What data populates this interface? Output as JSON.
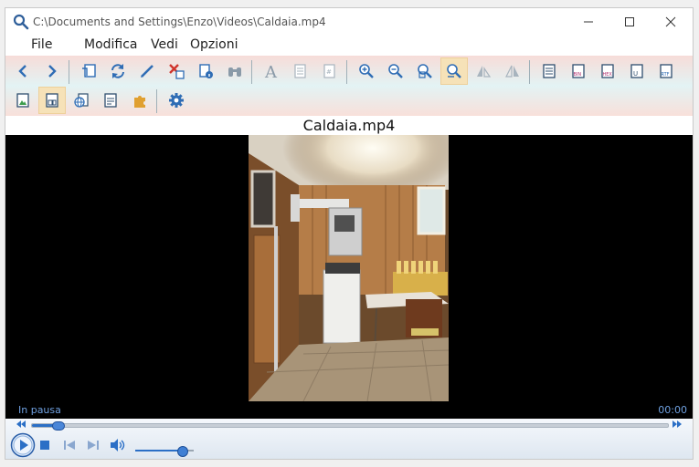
{
  "window": {
    "title": "C:\\Documents and Settings\\Enzo\\Videos\\Caldaia.mp4",
    "app_icon": "magnifier-icon"
  },
  "menu": [
    "File",
    "Modifica",
    "Vedi",
    "Opzioni"
  ],
  "toolbar": {
    "row1": [
      "back-arrow-icon",
      "forward-arrow-icon",
      "open-with-icon",
      "refresh-icon",
      "edit-pencil-icon",
      "delete-icon",
      "properties-icon",
      "binoculars-icon",
      "font-icon",
      "page-icon",
      "page-numbered-icon",
      "zoom-in-icon",
      "zoom-out-icon",
      "zoom-fit-icon",
      "zoom-original-icon",
      "flip-horizontal-icon",
      "flip-mirror-icon",
      "doc-icon",
      "bin-icon",
      "hex-icon",
      "unicode-icon",
      "rtf-icon"
    ],
    "row2": [
      "image-view-icon",
      "thumbnail-view-icon",
      "web-icon",
      "text-doc-icon",
      "plugin-icon",
      "settings-gear-icon"
    ],
    "labels": {
      "bin": "BIN",
      "hex": "HEX",
      "unicode": "U",
      "rtf": "RTF"
    }
  },
  "file_label": "Caldaia.mp4",
  "player": {
    "status": "In pausa",
    "time": "00:00",
    "seek_fraction": 0.04,
    "volume_fraction": 0.8
  },
  "colors": {
    "accent": "#2b6fc6",
    "toolbar_icon_blue": "#2f6db5",
    "status_text": "#6fa0e0"
  }
}
